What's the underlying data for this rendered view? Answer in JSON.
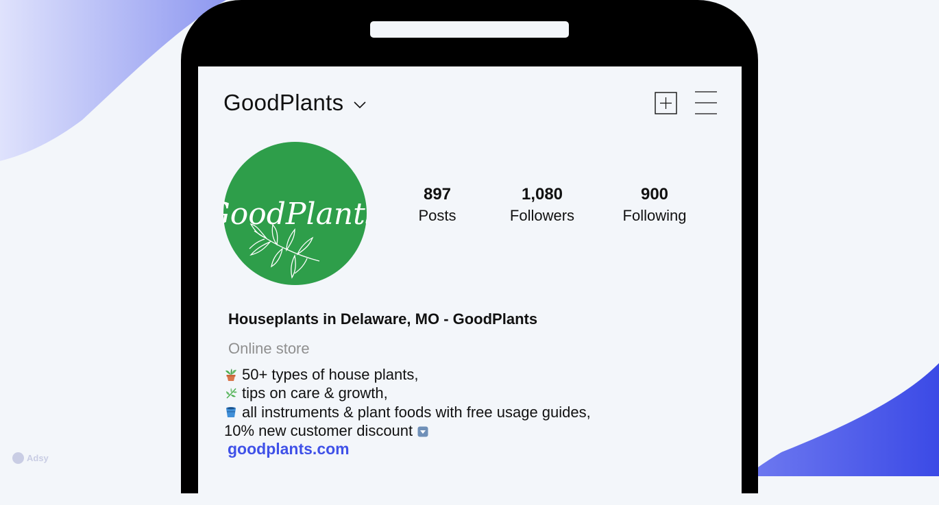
{
  "profile": {
    "username": "GoodPlants",
    "avatar_text": "GoodPlants",
    "stats": {
      "posts_count": "897",
      "posts_label": "Posts",
      "followers_count": "1,080",
      "followers_label": "Followers",
      "following_count": "900",
      "following_label": "Following"
    },
    "bio": {
      "name": "Houseplants in Delaware, MO - GoodPlants",
      "category": "Online store",
      "line1": "50+ types of house plants,",
      "line2": "tips on care & growth,",
      "line3": "all instruments & plant foods with free usage guides,",
      "line4": "10% new customer discount",
      "link": "goodplants.com"
    }
  },
  "icons": {
    "header_dropdown": "chevron-down-icon",
    "new_post": "plus-square-icon",
    "menu": "hamburger-menu-icon",
    "line1": "potted-plant-icon",
    "line2": "herb-icon",
    "line3": "bucket-icon",
    "line4": "down-arrow-button-icon"
  },
  "brand": {
    "label": "Adsy"
  },
  "colors": {
    "avatar_bg": "#2e9e4a",
    "link": "#3f51e8",
    "category": "#8f8f8f",
    "background": "#f3f6fa",
    "accent_gradient_start": "#d7dbfb",
    "accent_gradient_end": "#3c4ce6"
  }
}
